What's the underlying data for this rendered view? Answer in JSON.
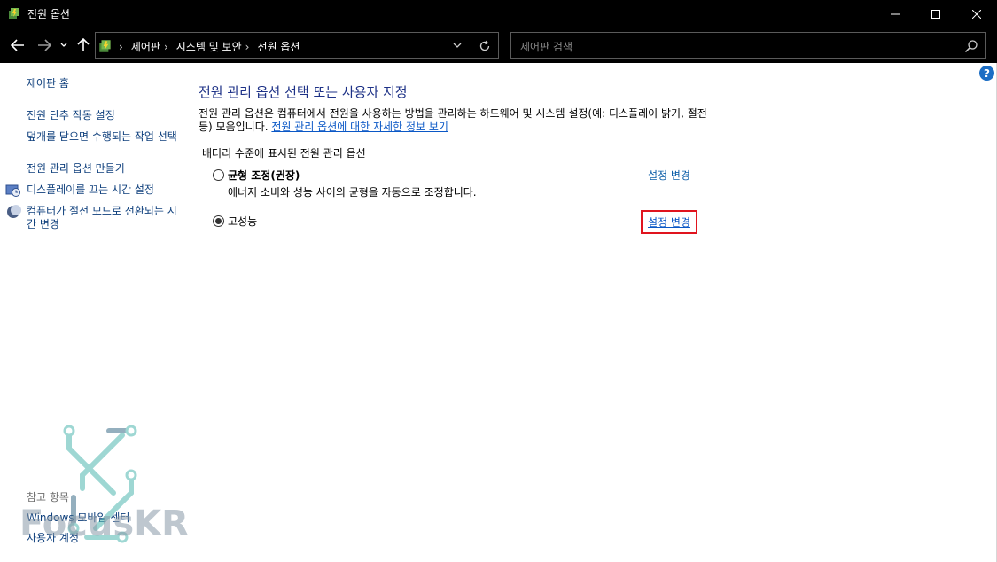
{
  "window": {
    "title": "전원 옵션"
  },
  "address": {
    "breadcrumbs": [
      "제어판",
      "시스템 및 보안",
      "전원 옵션"
    ]
  },
  "search": {
    "placeholder": "제어판 검색"
  },
  "sidebar": {
    "home": "제어판 홈",
    "items": [
      "전원 단추 작동 설정",
      "덮개를 닫으면 수행되는 작업 선택",
      "전원 관리 옵션 만들기",
      "디스플레이를 끄는 시간 설정",
      "컴퓨터가 절전 모드로 전환되는 시간 변경"
    ],
    "see_also_title": "참고 항목",
    "see_also": [
      "Windows 모바일 센터",
      "사용자 계정"
    ]
  },
  "main": {
    "title": "전원 관리 옵션 선택 또는 사용자 지정",
    "description": "전원 관리 옵션은 컴퓨터에서 전원을 사용하는 방법을 관리하는 하드웨어 및 시스템 설정(예: 디스플레이 밝기, 절전 등) 모음입니다.",
    "description_link": "전원 관리 옵션에 대한 자세한 정보 보기",
    "section_label": "배터리 수준에 표시된 전원 관리 옵션",
    "plans": [
      {
        "name": "균형 조정(권장)",
        "description": "에너지 소비와 성능 사이의 균형을 자동으로 조정합니다.",
        "change_label": "설정 변경",
        "selected": false
      },
      {
        "name": "고성능",
        "change_label": "설정 변경",
        "selected": true
      }
    ]
  },
  "watermark": {
    "text": "FocusKR"
  },
  "colors": {
    "link": "#0e3f7c",
    "title": "#1e3287",
    "highlight_border": "#e0141e"
  }
}
